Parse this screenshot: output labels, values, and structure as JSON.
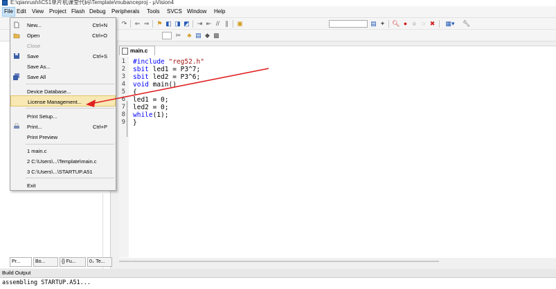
{
  "window": {
    "title": "E:\\qianrushi\\C51单片机课堂代码\\Template\\mubanceproj - μVision4"
  },
  "menubar": {
    "items": [
      "File",
      "Edit",
      "View",
      "Project",
      "Flash",
      "Debug",
      "Peripherals",
      "Tools",
      "SVCS",
      "Window",
      "Help"
    ]
  },
  "file_menu": {
    "items": [
      {
        "label": "New...",
        "shortcut": "Ctrl+N",
        "icon": "new-file-icon"
      },
      {
        "label": "Open",
        "shortcut": "Ctrl+O",
        "icon": "open-folder-icon"
      },
      {
        "label": "Close",
        "shortcut": ""
      },
      {
        "label": "Save",
        "shortcut": "Ctrl+S",
        "icon": "save-icon"
      },
      {
        "label": "Save As...",
        "shortcut": ""
      },
      {
        "label": "Save All",
        "shortcut": "",
        "icon": "save-all-icon"
      },
      {
        "label": "Device Database...",
        "shortcut": ""
      },
      {
        "label": "License Management...",
        "shortcut": ""
      },
      {
        "label": "Print Setup...",
        "shortcut": ""
      },
      {
        "label": "Print...",
        "shortcut": "Ctrl+P",
        "icon": "print-icon"
      },
      {
        "label": "Print Preview",
        "shortcut": ""
      },
      {
        "label": "1 main.c",
        "shortcut": ""
      },
      {
        "label": "2 C:\\Users\\...\\Template\\main.c",
        "shortcut": ""
      },
      {
        "label": "3 C:\\Users\\...\\STARTUP.A51",
        "shortcut": ""
      },
      {
        "label": "Exit",
        "shortcut": ""
      }
    ]
  },
  "editor": {
    "tab": "main.c",
    "lines": [
      {
        "n": "1",
        "parts": [
          {
            "t": "#include ",
            "c": "kw"
          },
          {
            "t": "\"reg52.h\"",
            "c": "str"
          }
        ]
      },
      {
        "n": "2",
        "parts": [
          {
            "t": "sbit",
            "c": "kw"
          },
          {
            "t": " led1 = P3^7;",
            "c": ""
          }
        ]
      },
      {
        "n": "3",
        "parts": [
          {
            "t": "sbit",
            "c": "kw"
          },
          {
            "t": " led2 = P3^6;",
            "c": ""
          }
        ]
      },
      {
        "n": "4",
        "parts": [
          {
            "t": "void",
            "c": "kw"
          },
          {
            "t": " main()",
            "c": ""
          }
        ]
      },
      {
        "n": "5",
        "parts": [
          {
            "t": "{",
            "c": ""
          }
        ]
      },
      {
        "n": "6",
        "parts": [
          {
            "t": "led1 = 0;",
            "c": ""
          }
        ]
      },
      {
        "n": "7",
        "parts": [
          {
            "t": "led2 = 0;",
            "c": ""
          }
        ]
      },
      {
        "n": "8",
        "parts": [
          {
            "t": "while",
            "c": "kw"
          },
          {
            "t": "(1);",
            "c": ""
          }
        ]
      },
      {
        "n": "9",
        "parts": [
          {
            "t": "}",
            "c": ""
          }
        ]
      }
    ]
  },
  "left_panel": {
    "tabs": [
      "Pr...",
      "Bo...",
      "{} Fu...",
      "0₊ Te..."
    ]
  },
  "build_output": {
    "title": "Build Output",
    "line": "assembling STARTUP.A51..."
  },
  "colors": {
    "keyword": "#0000ff",
    "string": "#a31515",
    "annotation_arrow": "#e02020",
    "menu_highlight": "#f8e8b4"
  }
}
